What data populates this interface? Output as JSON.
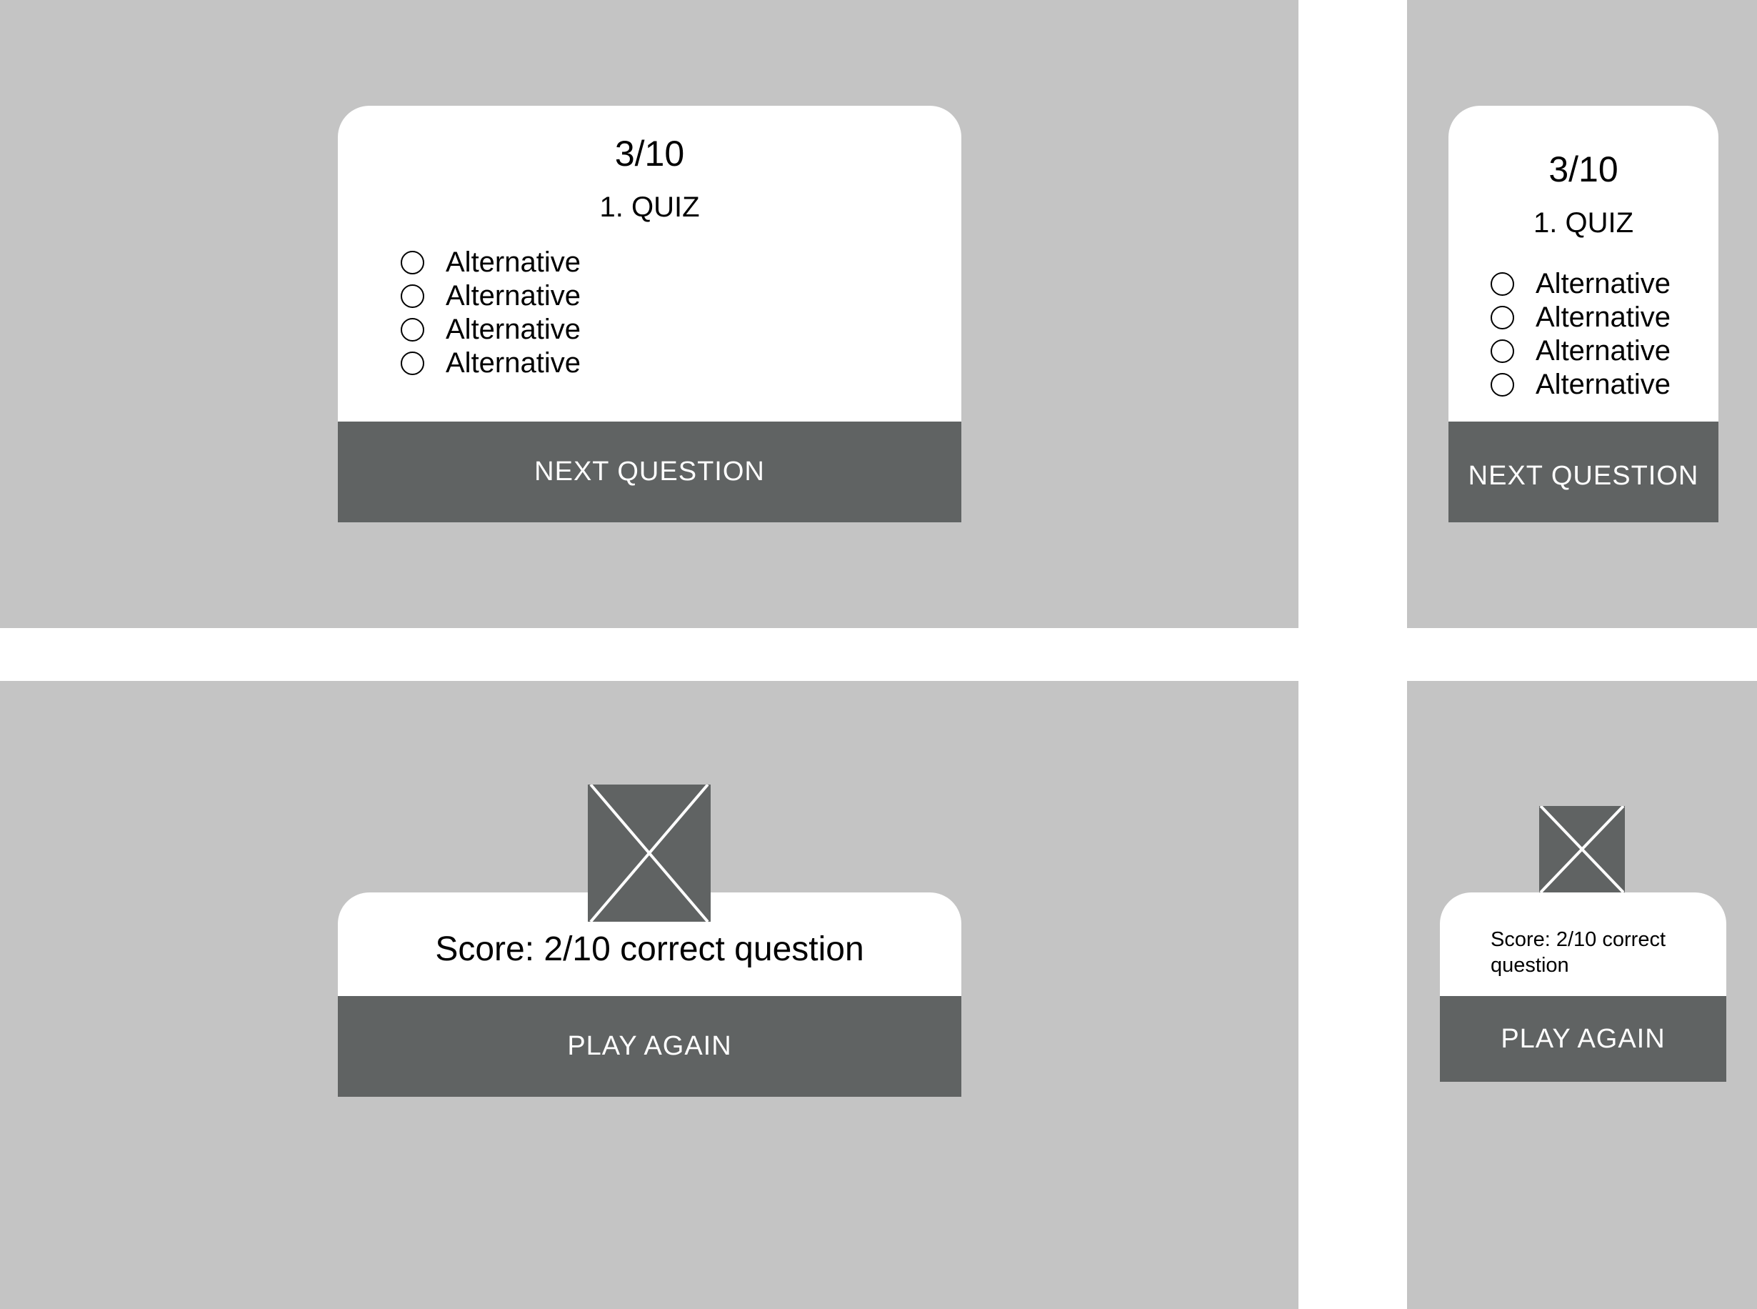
{
  "desktop_question": {
    "counter": "3/10",
    "title": "1. QUIZ",
    "options": [
      "Alternative",
      "Alternative",
      "Alternative",
      "Alternative"
    ],
    "next_label": "NEXT QUESTION"
  },
  "mobile_question": {
    "counter": "3/10",
    "title": "1. QUIZ",
    "options": [
      "Alternative",
      "Alternative",
      "Alternative",
      "Alternative"
    ],
    "next_label": "NEXT QUESTION"
  },
  "desktop_result": {
    "image_icon": "image-placeholder-icon",
    "score": "Score: 2/10 correct question",
    "play_again_label": "PLAY AGAIN"
  },
  "mobile_result": {
    "image_icon": "image-placeholder-icon",
    "score": "Score: 2/10 correct question",
    "play_again_label": "PLAY AGAIN"
  },
  "colors": {
    "background": "#c4c4c4",
    "card": "#ffffff",
    "button": "#606363",
    "button_text": "#ffffff"
  }
}
